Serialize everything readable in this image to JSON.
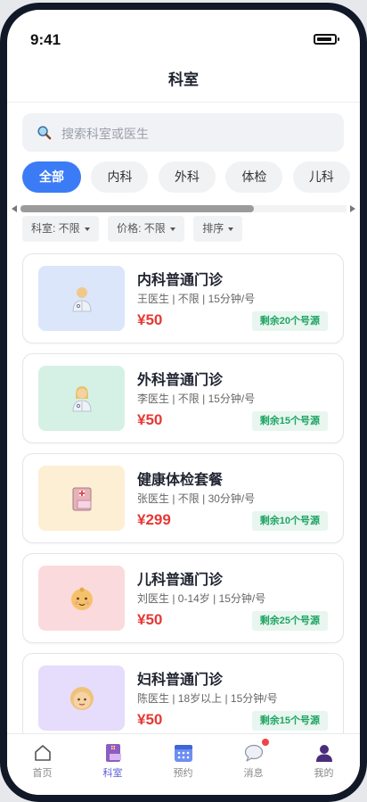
{
  "status_bar": {
    "time": "9:41"
  },
  "header": {
    "title": "科室"
  },
  "search": {
    "placeholder": "搜索科室或医生"
  },
  "categories": [
    {
      "label": "全部",
      "active": true
    },
    {
      "label": "内科",
      "active": false
    },
    {
      "label": "外科",
      "active": false
    },
    {
      "label": "体检",
      "active": false
    },
    {
      "label": "儿科",
      "active": false
    }
  ],
  "filters": [
    {
      "label": "科室: 不限"
    },
    {
      "label": "价格: 不限"
    },
    {
      "label": "排序"
    }
  ],
  "services": [
    {
      "name": "内科普通门诊",
      "meta": "王医生 | 不限 | 15分钟/号",
      "price": "¥50",
      "remaining": "剩余20个号源",
      "thumb_color": "#dbe6fb",
      "icon": "doctor-icon"
    },
    {
      "name": "外科普通门诊",
      "meta": "李医生 | 不限 | 15分钟/号",
      "price": "¥50",
      "remaining": "剩余15个号源",
      "thumb_color": "#d5f1e6",
      "icon": "doctor-icon"
    },
    {
      "name": "健康体检套餐",
      "meta": "张医生 | 不限 | 30分钟/号",
      "price": "¥299",
      "remaining": "剩余10个号源",
      "thumb_color": "#fdefd3",
      "icon": "hospital-icon"
    },
    {
      "name": "儿科普通门诊",
      "meta": "刘医生 | 0-14岁 | 15分钟/号",
      "price": "¥50",
      "remaining": "剩余25个号源",
      "thumb_color": "#fbdadd",
      "icon": "baby-icon"
    },
    {
      "name": "妇科普通门诊",
      "meta": "陈医生 | 18岁以上 | 15分钟/号",
      "price": "¥50",
      "remaining": "剩余15个号源",
      "thumb_color": "#e6dcfb",
      "icon": "woman-icon"
    }
  ],
  "tabbar": {
    "items": [
      {
        "label": "首页",
        "icon": "home-icon",
        "active": false
      },
      {
        "label": "科室",
        "icon": "department-icon",
        "active": true
      },
      {
        "label": "预约",
        "icon": "calendar-icon",
        "active": false
      },
      {
        "label": "消息",
        "icon": "message-icon",
        "active": false,
        "badge": true
      },
      {
        "label": "我的",
        "icon": "profile-icon",
        "active": false
      }
    ]
  },
  "colors": {
    "accent": "#3b7cf6",
    "price": "#e53935",
    "badge": "#1fa463",
    "tab_active": "#5b5bd6"
  }
}
